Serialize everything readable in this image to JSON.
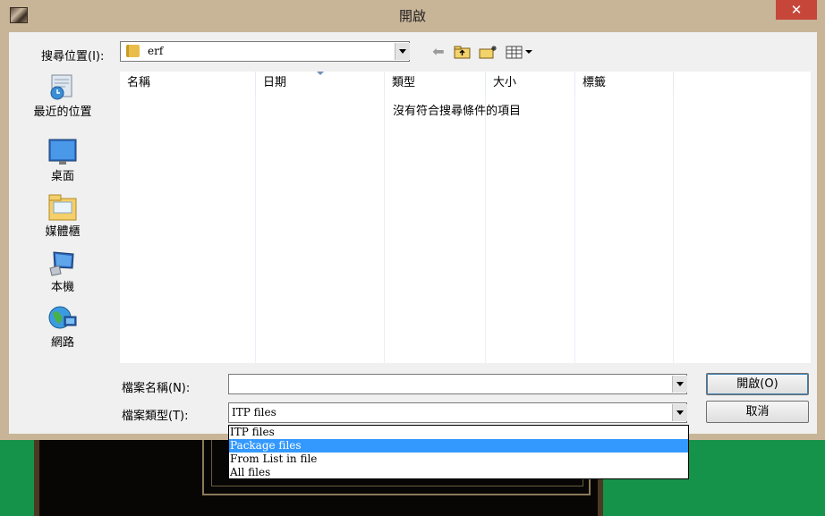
{
  "window": {
    "title": "開啟",
    "close_glyph": "✕"
  },
  "lookin": {
    "label": "搜尋位置(I):",
    "value": "erf"
  },
  "places": [
    {
      "label": "最近的位置",
      "icon": "recent-places-icon"
    },
    {
      "label": "桌面",
      "icon": "desktop-icon"
    },
    {
      "label": "媒體櫃",
      "icon": "libraries-icon"
    },
    {
      "label": "本機",
      "icon": "computer-icon"
    },
    {
      "label": "網路",
      "icon": "network-icon"
    }
  ],
  "filelist": {
    "columns": [
      "名稱",
      "日期",
      "類型",
      "大小",
      "標籤"
    ],
    "empty_message": "沒有符合搜尋條件的項目"
  },
  "filename": {
    "label": "檔案名稱(N):",
    "value": ""
  },
  "filetype": {
    "label": "檔案類型(T):",
    "value": "ITP files",
    "options": [
      "ITP files",
      "Package files",
      "From List in file",
      "All files"
    ],
    "highlighted_index": 1
  },
  "buttons": {
    "open": "開啟(O)",
    "cancel": "取消"
  },
  "colors": {
    "selection": "#3399ff",
    "close_button": "#c7463a",
    "title_bar": "#c8b497"
  }
}
